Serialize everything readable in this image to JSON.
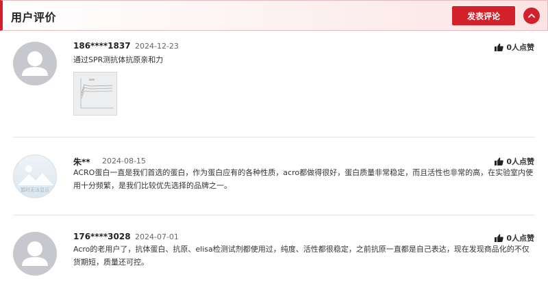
{
  "header": {
    "title": "用户评价",
    "post_label": "发表评论",
    "collapse_icon": "chevron-up-icon"
  },
  "colors": {
    "accent": "#d3212c",
    "avatar_grey": "#c6c8cd"
  },
  "reviews": [
    {
      "username": "186****1837",
      "date": "2024-12-23",
      "likes": "0人点赞",
      "content": "通过SPR测抗体抗原亲和力",
      "has_image": true
    },
    {
      "username": "朱**",
      "date": "2024-08-15",
      "likes": "0人点赞",
      "content": "ACRO蛋白一直是我们首选的蛋白，作为蛋白应有的各种性质，acro都做得很好，蛋白质量非常稳定，而且活性也非常的高，在实验室内使用十分频繁，是我们比较优先选择的品牌之一。",
      "avatar_text": "暂时无法显示"
    },
    {
      "username": "176****3028",
      "date": "2024-07-01",
      "likes": "0人点赞",
      "content": "Acro的老用户了，抗体蛋白、抗原、elisa检测试剂都使用过，纯度、活性都很稳定，之前抗原一直都是自己表达，现在发现商品化的不仅货期短，质量还可控。"
    }
  ]
}
